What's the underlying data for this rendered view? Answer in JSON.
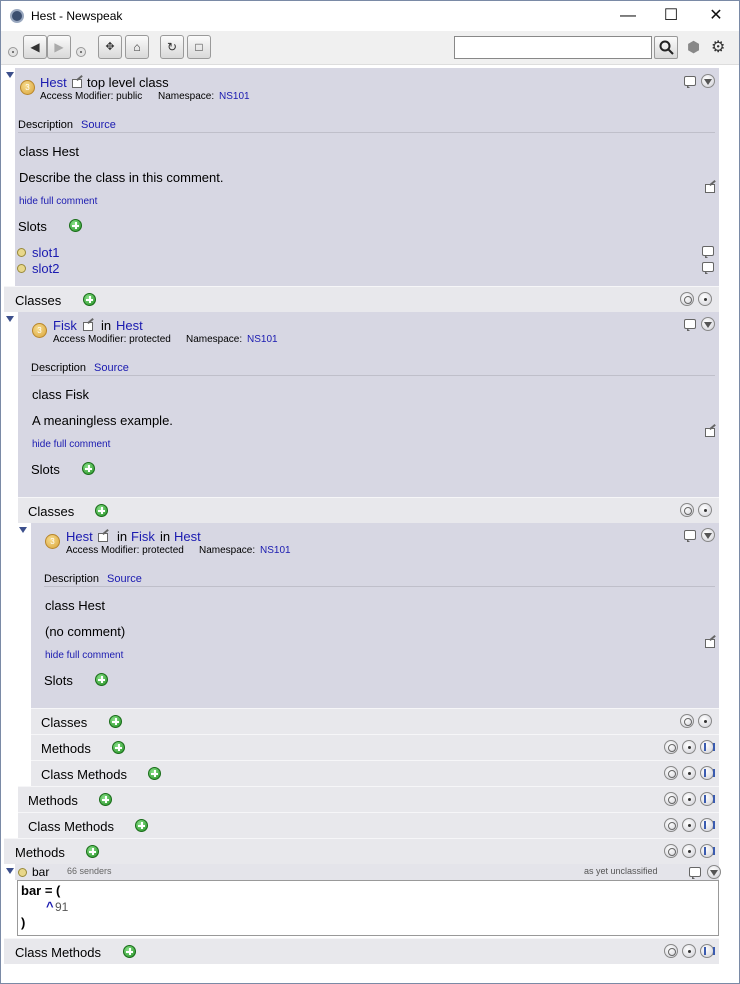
{
  "window": {
    "title": "Hest - Newspeak"
  },
  "toolbar": {
    "search_placeholder": ""
  },
  "top": {
    "name": "Hest",
    "kind": "top level class",
    "access_label": "Access Modifier: public",
    "ns_label": "Namespace:",
    "ns": "NS101",
    "desc_tab": "Description",
    "source_tab": "Source",
    "decl": "class Hest",
    "comment": "Describe the class in this comment.",
    "hide": "hide full comment",
    "slots_label": "Slots",
    "slots": [
      "slot1",
      "slot2"
    ],
    "classes_label": "Classes"
  },
  "fisk": {
    "name": "Fisk",
    "in_word": "in",
    "parent": "Hest",
    "access_label": "Access Modifier: protected",
    "ns_label": "Namespace:",
    "ns": "NS101",
    "desc_tab": "Description",
    "source_tab": "Source",
    "decl": "class Fisk",
    "comment": "A meaningless example.",
    "hide": "hide full comment",
    "slots_label": "Slots",
    "classes_label": "Classes"
  },
  "inner": {
    "name": "Hest",
    "in_word": "in",
    "parent1": "Fisk",
    "in_word2": "in",
    "parent2": "Hest",
    "access_label": "Access Modifier: protected",
    "ns_label": "Namespace:",
    "ns": "NS101",
    "desc_tab": "Description",
    "source_tab": "Source",
    "decl": "class Hest",
    "comment": "(no comment)",
    "hide": "hide full comment",
    "slots_label": "Slots",
    "classes_label": "Classes",
    "methods_label": "Methods",
    "class_methods_label": "Class Methods"
  },
  "fisk_methods_label": "Methods",
  "fisk_class_methods_label": "Class Methods",
  "top_methods_label": "Methods",
  "method": {
    "name": "bar",
    "senders": "66 senders",
    "category": "as yet unclassified",
    "code_line1": "bar = (",
    "code_caret": "^",
    "code_value": "91",
    "code_line3": ")"
  },
  "top_class_methods_label": "Class Methods"
}
